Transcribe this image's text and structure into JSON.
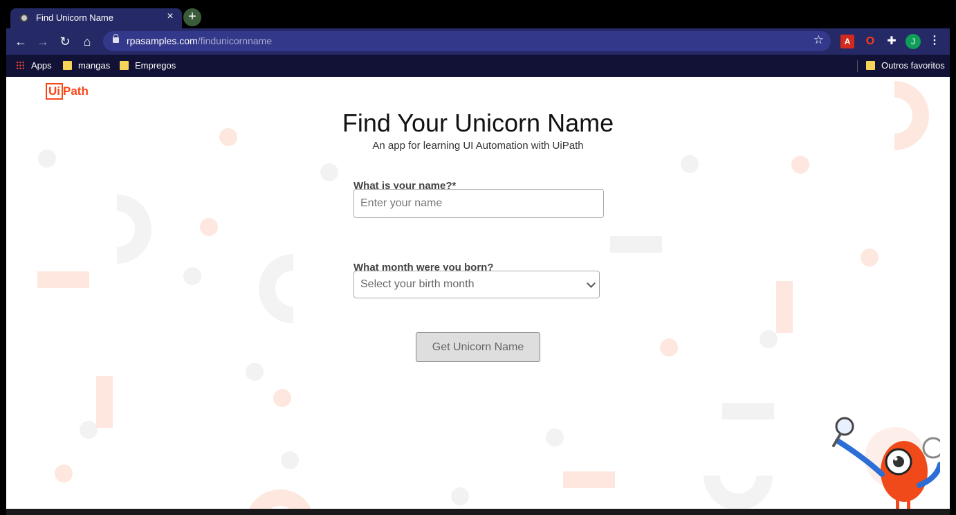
{
  "browser": {
    "tab_title": "Find Unicorn Name",
    "tab_close": "×",
    "new_tab": "+",
    "url_host": "rpasamples.com",
    "url_path": "/findunicornname",
    "profile_initial": "J",
    "bookmarks": [
      {
        "label": "Apps",
        "icon": "apps-grid-icon"
      },
      {
        "label": "mangas",
        "icon": "folder-icon"
      },
      {
        "label": "Empregos",
        "icon": "folder-icon"
      }
    ],
    "other_bookmarks": "Outros favoritos"
  },
  "page": {
    "logo_box": "Ui",
    "logo_rest": "Path",
    "title": "Find Your Unicorn Name",
    "subtitle": "An app for learning UI Automation with UiPath",
    "name_label": "What is your name?*",
    "name_placeholder": "Enter your name",
    "month_label": "What month were you born?",
    "month_placeholder": "Select your birth month",
    "submit_label": "Get Unicorn Name"
  },
  "colors": {
    "brand": "#fa4616",
    "chrome_toolbar": "#252a66",
    "bookmarks_bar": "#111236"
  }
}
